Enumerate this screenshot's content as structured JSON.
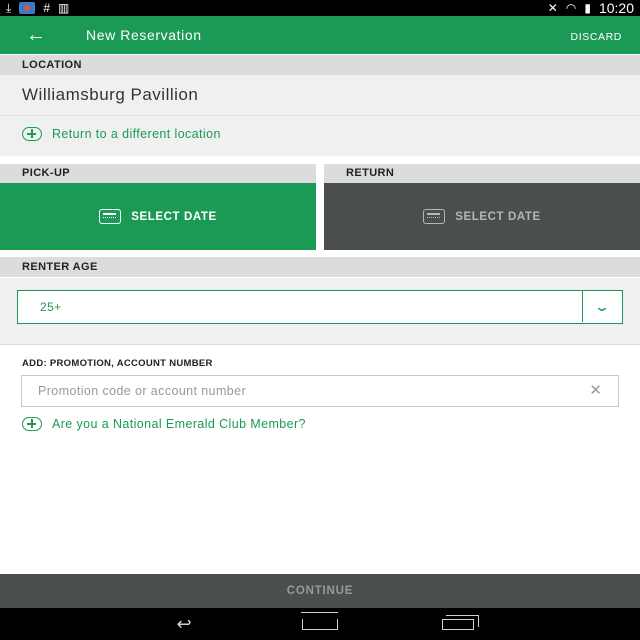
{
  "status_bar": {
    "time": "10:20",
    "left_icons": [
      "download-icon",
      "photo-icon",
      "hashtag-icon",
      "barcode-icon"
    ],
    "right_icons": [
      "mute-icon",
      "wifi-icon",
      "battery-icon"
    ]
  },
  "app_bar": {
    "title": "New Reservation",
    "discard_label": "DISCARD",
    "back_icon": "arrow-left-icon",
    "color": "#1a9a55"
  },
  "location": {
    "header": "LOCATION",
    "name": "Williamsburg Pavillion",
    "return_different_label": "Return to a different location"
  },
  "pickup": {
    "header": "PICK-UP",
    "button_label": "SELECT DATE"
  },
  "return": {
    "header": "RETURN",
    "button_label": "SELECT DATE"
  },
  "renter_age": {
    "header": "RENTER AGE",
    "selected": "25+"
  },
  "promotion": {
    "label": "ADD: PROMOTION, ACCOUNT NUMBER",
    "placeholder": "Promotion code or account number",
    "value": ""
  },
  "emerald_club": {
    "label": "Are you a National Emerald Club Member?"
  },
  "continue": {
    "label": "CONTINUE"
  },
  "colors": {
    "accent": "#1a9a55",
    "dark_button": "#4a4f4c",
    "section_header_bg": "#dcdcdc"
  }
}
